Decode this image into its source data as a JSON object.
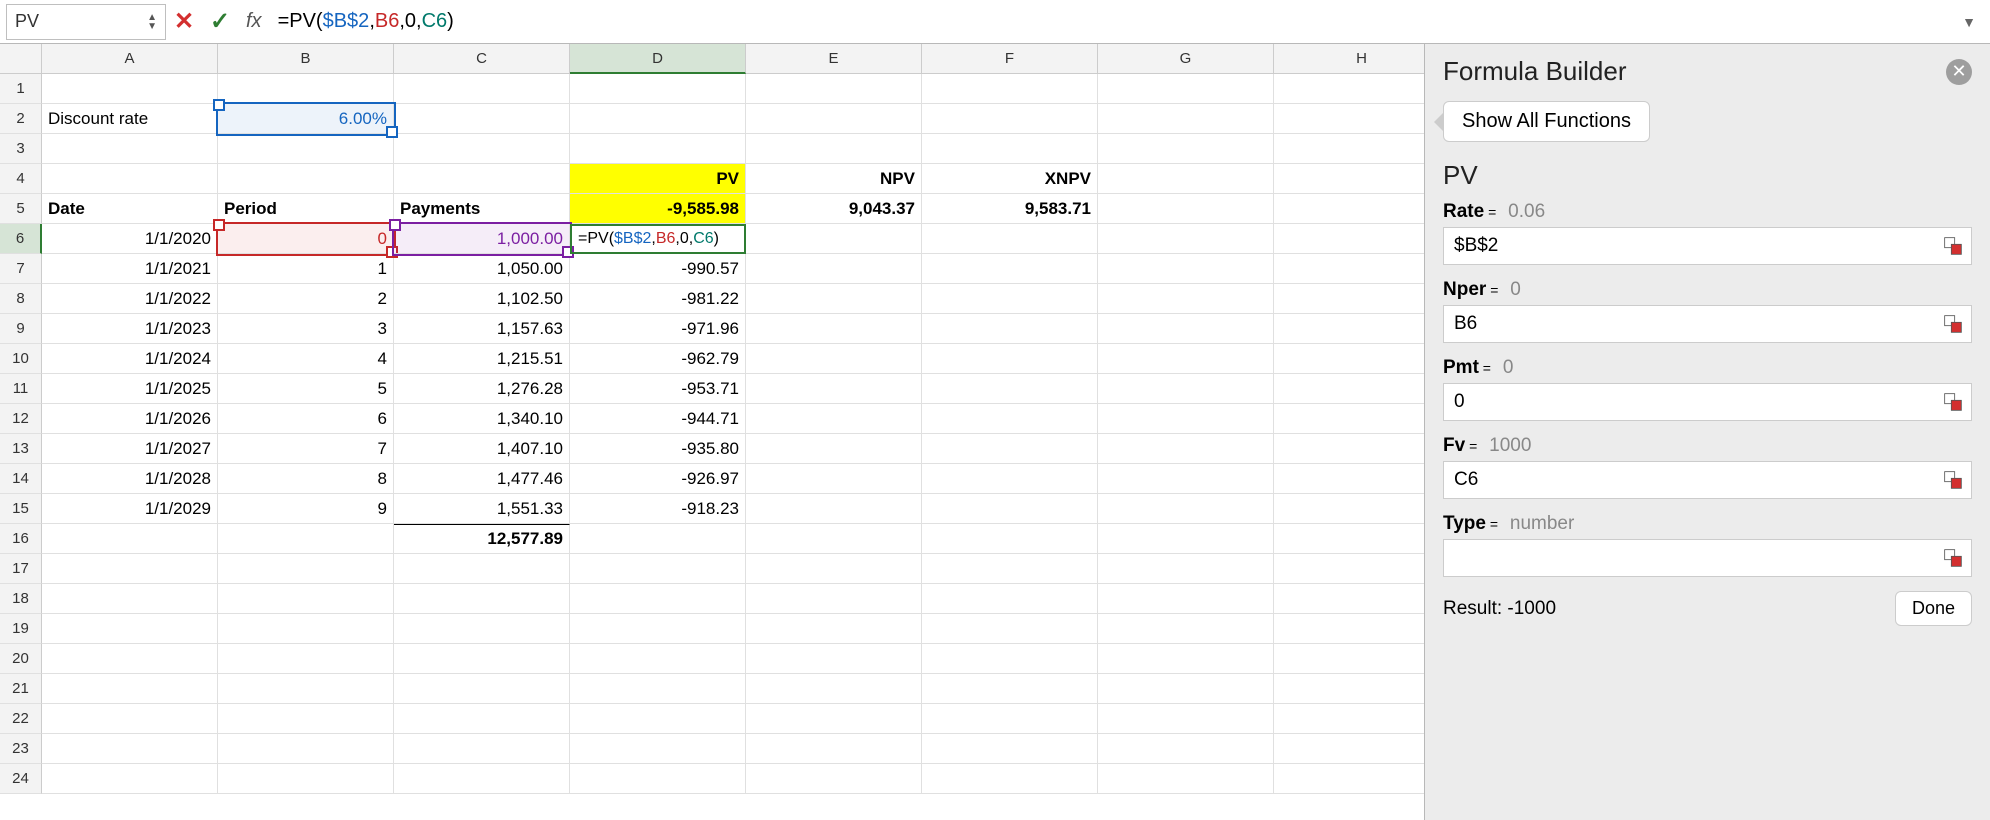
{
  "formula_bar": {
    "cell_ref": "PV",
    "fx_label": "fx",
    "formula": "=PV($B$2,B6,0,C6)",
    "tokens": {
      "pre": "=PV(",
      "a1": "$B$2",
      "c1": ",",
      "a2": "B6",
      "c2": ",0,",
      "a3": "C6",
      "post": ")"
    }
  },
  "columns": [
    "A",
    "B",
    "C",
    "D",
    "E",
    "F",
    "G",
    "H"
  ],
  "row_labels": [
    "1",
    "2",
    "3",
    "4",
    "5",
    "6",
    "7",
    "8",
    "9",
    "10",
    "11",
    "12",
    "13",
    "14",
    "15",
    "16",
    "17",
    "18",
    "19",
    "20",
    "21",
    "22",
    "23",
    "24"
  ],
  "sheet": {
    "discount_label": "Discount rate",
    "discount_value": "6.00%",
    "hdr": {
      "date": "Date",
      "period": "Period",
      "payments": "Payments",
      "pv": "PV",
      "npv": "NPV",
      "xnpv": "XNPV"
    },
    "pv_total": "-9,585.98",
    "npv_total": "9,043.37",
    "xnpv_total": "9,583.71",
    "rows": [
      {
        "date": "1/1/2020",
        "period": "0",
        "payment": "1,000.00",
        "pv": ""
      },
      {
        "date": "1/1/2021",
        "period": "1",
        "payment": "1,050.00",
        "pv": "-990.57"
      },
      {
        "date": "1/1/2022",
        "period": "2",
        "payment": "1,102.50",
        "pv": "-981.22"
      },
      {
        "date": "1/1/2023",
        "period": "3",
        "payment": "1,157.63",
        "pv": "-971.96"
      },
      {
        "date": "1/1/2024",
        "period": "4",
        "payment": "1,215.51",
        "pv": "-962.79"
      },
      {
        "date": "1/1/2025",
        "period": "5",
        "payment": "1,276.28",
        "pv": "-953.71"
      },
      {
        "date": "1/1/2026",
        "period": "6",
        "payment": "1,340.10",
        "pv": "-944.71"
      },
      {
        "date": "1/1/2027",
        "period": "7",
        "payment": "1,407.10",
        "pv": "-935.80"
      },
      {
        "date": "1/1/2028",
        "period": "8",
        "payment": "1,477.46",
        "pv": "-926.97"
      },
      {
        "date": "1/1/2029",
        "period": "9",
        "payment": "1,551.33",
        "pv": "-918.23"
      }
    ],
    "payments_sum": "12,577.89",
    "editing_formula": {
      "pre": "=PV(",
      "a1": "$B$2",
      "c1": ",",
      "a2": "B6",
      "c2": ",0,",
      "a3": "C6",
      "post": ")"
    }
  },
  "panel": {
    "title": "Formula Builder",
    "show_all": "Show All Functions",
    "fn": "PV",
    "args": [
      {
        "name": "Rate",
        "val": "0.06",
        "input": "$B$2"
      },
      {
        "name": "Nper",
        "val": "0",
        "input": "B6"
      },
      {
        "name": "Pmt",
        "val": "0",
        "input": "0"
      },
      {
        "name": "Fv",
        "val": "1000",
        "input": "C6"
      },
      {
        "name": "Type",
        "val": "number",
        "input": ""
      }
    ],
    "result_label": "Result: -1000",
    "done": "Done"
  },
  "chart_data": {
    "type": "table",
    "title": "PV / NPV / XNPV worksheet",
    "discount_rate": 0.06,
    "columns": [
      "Date",
      "Period",
      "Payments",
      "PV"
    ],
    "rows": [
      [
        "1/1/2020",
        0,
        1000.0,
        null
      ],
      [
        "1/1/2021",
        1,
        1050.0,
        -990.57
      ],
      [
        "1/1/2022",
        2,
        1102.5,
        -981.22
      ],
      [
        "1/1/2023",
        3,
        1157.63,
        -971.96
      ],
      [
        "1/1/2024",
        4,
        1215.51,
        -962.79
      ],
      [
        "1/1/2025",
        5,
        1276.28,
        -953.71
      ],
      [
        "1/1/2026",
        6,
        1340.1,
        -944.71
      ],
      [
        "1/1/2027",
        7,
        1407.1,
        -935.8
      ],
      [
        "1/1/2028",
        8,
        1477.46,
        -926.97
      ],
      [
        "1/1/2029",
        9,
        1551.33,
        -918.23
      ]
    ],
    "sum_payments": 12577.89,
    "pv_total": -9585.98,
    "npv_total": 9043.37,
    "xnpv_total": 9583.71
  }
}
